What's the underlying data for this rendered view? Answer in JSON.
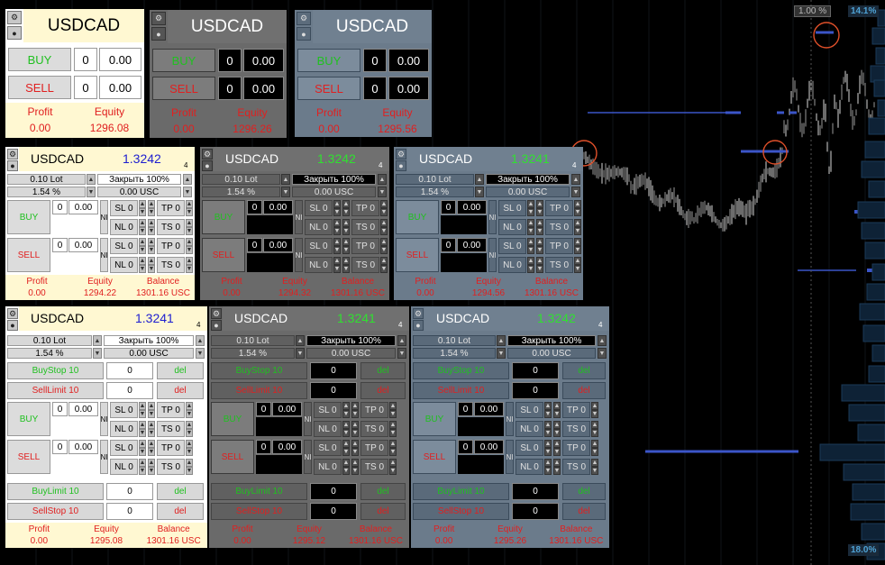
{
  "symbol": "USDCAD",
  "chart": {
    "top_label": "1.00 %",
    "pct_top": "14.1%",
    "pct_bottom": "18.0%"
  },
  "panels_small": [
    {
      "theme": "light",
      "buy": "BUY",
      "sell": "SELL",
      "buy_qty": "0",
      "buy_price": "0.00",
      "sell_qty": "0",
      "sell_price": "0.00",
      "profit_label": "Profit",
      "equity_label": "Equity",
      "profit": "0.00",
      "equity": "1296.08"
    },
    {
      "theme": "gray",
      "buy": "BUY",
      "sell": "SELL",
      "buy_qty": "0",
      "buy_price": "0.00",
      "sell_qty": "0",
      "sell_price": "0.00",
      "profit_label": "Profit",
      "equity_label": "Equity",
      "profit": "0.00",
      "equity": "1296.26"
    },
    {
      "theme": "slate",
      "buy": "BUY",
      "sell": "SELL",
      "buy_qty": "0",
      "buy_price": "0.00",
      "sell_qty": "0",
      "sell_price": "0.00",
      "profit_label": "Profit",
      "equity_label": "Equity",
      "profit": "0.00",
      "equity": "1295.56"
    }
  ],
  "panels_mid": [
    {
      "theme": "light",
      "price": "1.3242",
      "digits": "4",
      "lot": "0.10 Lot",
      "close": "Закрыть 100%",
      "pct": "1.54 %",
      "usd": "0.00 USC",
      "buy": "BUY",
      "sell": "SELL",
      "buy_qty": "0",
      "buy_price": "0.00",
      "sell_qty": "0",
      "sell_price": "0.00",
      "ni": "NI",
      "sl": "SL 0",
      "tp": "TP 0",
      "nl": "NL 0",
      "ts": "TS 0",
      "profit_label": "Profit",
      "equity_label": "Equity",
      "balance_label": "Balance",
      "profit": "0.00",
      "equity": "1294.22",
      "balance": "1301.16 USC"
    },
    {
      "theme": "gray",
      "price": "1.3242",
      "digits": "4",
      "lot": "0.10 Lot",
      "close": "Закрыть 100%",
      "pct": "1.54 %",
      "usd": "0.00 USC",
      "buy": "BUY",
      "sell": "SELL",
      "buy_qty": "0",
      "buy_price": "0.00",
      "sell_qty": "0",
      "sell_price": "0.00",
      "ni": "NI",
      "sl": "SL 0",
      "tp": "TP 0",
      "nl": "NL 0",
      "ts": "TS 0",
      "profit_label": "Profit",
      "equity_label": "Equity",
      "balance_label": "Balance",
      "profit": "0.00",
      "equity": "1294.32",
      "balance": "1301.16 USC"
    },
    {
      "theme": "slate",
      "price": "1.3241",
      "digits": "4",
      "lot": "0.10 Lot",
      "close": "Закрыть 100%",
      "pct": "1.54 %",
      "usd": "0.00 USC",
      "buy": "BUY",
      "sell": "SELL",
      "buy_qty": "0",
      "buy_price": "0.00",
      "sell_qty": "0",
      "sell_price": "0.00",
      "ni": "NI",
      "sl": "SL 0",
      "tp": "TP 0",
      "nl": "NL 0",
      "ts": "TS 0",
      "profit_label": "Profit",
      "equity_label": "Equity",
      "balance_label": "Balance",
      "profit": "0.00",
      "equity": "1294.56",
      "balance": "1301.16 USC"
    }
  ],
  "panels_large": [
    {
      "theme": "light",
      "price": "1.3241",
      "digits": "4",
      "lot": "0.10 Lot",
      "close": "Закрыть 100%",
      "pct": "1.54 %",
      "usd": "0.00 USC",
      "buystop": "BuyStop 10",
      "selllimit": "SellLimit 10",
      "buylimit": "BuyLimit 10",
      "sellstop": "SellStop 10",
      "del": "del",
      "zero": "0",
      "buy": "BUY",
      "sell": "SELL",
      "buy_qty": "0",
      "buy_price": "0.00",
      "sell_qty": "0",
      "sell_price": "0.00",
      "ni": "NI",
      "sl": "SL 0",
      "tp": "TP 0",
      "nl": "NL 0",
      "ts": "TS 0",
      "profit_label": "Profit",
      "equity_label": "Equity",
      "balance_label": "Balance",
      "profit": "0.00",
      "equity": "1295.08",
      "balance": "1301.16 USC"
    },
    {
      "theme": "gray",
      "price": "1.3241",
      "digits": "4",
      "lot": "0.10 Lot",
      "close": "Закрыть 100%",
      "pct": "1.54 %",
      "usd": "0.00 USC",
      "buystop": "BuyStop 10",
      "selllimit": "SellLimit 10",
      "buylimit": "BuyLimit 10",
      "sellstop": "SellStop 10",
      "del": "del",
      "zero": "0",
      "buy": "BUY",
      "sell": "SELL",
      "buy_qty": "0",
      "buy_price": "0.00",
      "sell_qty": "0",
      "sell_price": "0.00",
      "ni": "NI",
      "sl": "SL 0",
      "tp": "TP 0",
      "nl": "NL 0",
      "ts": "TS 0",
      "profit_label": "Profit",
      "equity_label": "Equity",
      "balance_label": "Balance",
      "profit": "0.00",
      "equity": "1295.12",
      "balance": "1301.16 USC"
    },
    {
      "theme": "slate",
      "price": "1.3242",
      "digits": "4",
      "lot": "0.10 Lot",
      "close": "Закрыть 100%",
      "pct": "1.54 %",
      "usd": "0.00 USC",
      "buystop": "BuyStop 10",
      "selllimit": "SellLimit 10",
      "buylimit": "BuyLimit 10",
      "sellstop": "SellStop 10",
      "del": "del",
      "zero": "0",
      "buy": "BUY",
      "sell": "SELL",
      "buy_qty": "0",
      "buy_price": "0.00",
      "sell_qty": "0",
      "sell_price": "0.00",
      "ni": "NI",
      "sl": "SL 0",
      "tp": "TP 0",
      "nl": "NL 0",
      "ts": "TS 0",
      "profit_label": "Profit",
      "equity_label": "Equity",
      "balance_label": "Balance",
      "profit": "0.00",
      "equity": "1295.26",
      "balance": "1301.16 USC"
    }
  ]
}
